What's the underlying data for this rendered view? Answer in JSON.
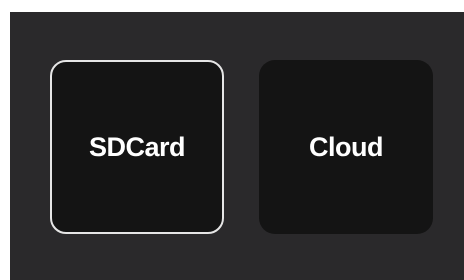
{
  "storage": {
    "options": [
      {
        "label": "SDCard",
        "selected": true
      },
      {
        "label": "Cloud",
        "selected": false
      }
    ]
  },
  "colors": {
    "panel_background": "#2a292b",
    "tile_background": "#141414",
    "selected_border": "#e6e6e6",
    "text": "#ffffff"
  }
}
